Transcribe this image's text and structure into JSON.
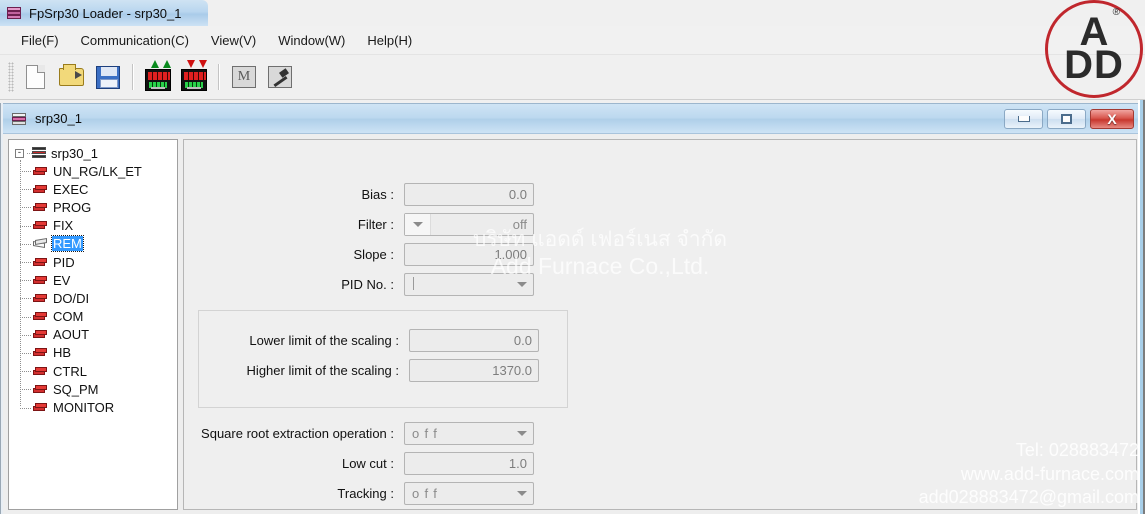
{
  "app": {
    "title": "FpSrp30 Loader - srp30_1",
    "icon": "books-stack-icon"
  },
  "menubar": {
    "items": [
      {
        "label": "File(F)",
        "name": "menu-file"
      },
      {
        "label": "Communication(C)",
        "name": "menu-communication"
      },
      {
        "label": "View(V)",
        "name": "menu-view"
      },
      {
        "label": "Window(W)",
        "name": "menu-window"
      },
      {
        "label": "Help(H)",
        "name": "menu-help"
      }
    ]
  },
  "toolbar": {
    "buttons": [
      {
        "name": "new-file-button",
        "icon": "new-document-icon",
        "title": "New"
      },
      {
        "name": "open-file-button",
        "icon": "open-folder-icon",
        "title": "Open"
      },
      {
        "name": "save-file-button",
        "icon": "floppy-disk-save-icon",
        "title": "Save"
      },
      {
        "name": "upload-button",
        "icon": "device-upload-green-arrows-icon",
        "title": "Upload"
      },
      {
        "name": "download-button",
        "icon": "device-download-red-arrows-icon",
        "title": "Download"
      },
      {
        "name": "monitor-button",
        "icon": "monitor-m-icon",
        "title": "Monitor"
      },
      {
        "name": "tools-button",
        "icon": "hammer-tool-icon",
        "title": "Tools"
      }
    ]
  },
  "mdi": {
    "title": "srp30_1",
    "icon": "document-pen-icon",
    "controls": {
      "minimize": "minimize-icon",
      "maximize": "maximize-icon",
      "close": "X"
    }
  },
  "tree": {
    "root": {
      "label": "srp30_1",
      "expander": "-"
    },
    "items": [
      {
        "label": "UN_RG/LK_ET",
        "selected": false
      },
      {
        "label": "EXEC",
        "selected": false
      },
      {
        "label": "PROG",
        "selected": false
      },
      {
        "label": "FIX",
        "selected": false
      },
      {
        "label": "REM",
        "selected": true
      },
      {
        "label": "PID",
        "selected": false
      },
      {
        "label": "EV",
        "selected": false
      },
      {
        "label": "DO/DI",
        "selected": false
      },
      {
        "label": "COM",
        "selected": false
      },
      {
        "label": "AOUT",
        "selected": false
      },
      {
        "label": "HB",
        "selected": false
      },
      {
        "label": "CTRL",
        "selected": false
      },
      {
        "label": "SQ_PM",
        "selected": false
      },
      {
        "label": "MONITOR",
        "selected": false
      }
    ]
  },
  "form": {
    "bias": {
      "label": "Bias :",
      "value": "0.0"
    },
    "filter": {
      "label": "Filter :",
      "value": "off"
    },
    "slope": {
      "label": "Slope :",
      "value": "1.000"
    },
    "pid_no": {
      "label": "PID No. :",
      "value": ""
    },
    "scaling": {
      "lower": {
        "label": "Lower limit of the scaling :",
        "value": "0.0"
      },
      "higher": {
        "label": "Higher limit of the scaling :",
        "value": "1370.0"
      }
    },
    "sqrt": {
      "label": "Square root extraction operation :",
      "value": "o f f"
    },
    "low_cut": {
      "label": "Low cut :",
      "value": "1.0"
    },
    "tracking": {
      "label": "Tracking :",
      "value": "o f f"
    }
  },
  "watermark": {
    "center_thai": "บริษัท แอดด์ เฟอร์เนส จำกัด",
    "center_english": "Add Furnace Co.,Ltd.",
    "tel": "Tel: 028883472",
    "website": "www.add-furnace.com",
    "email": "add028883472@gmail.com"
  },
  "logo": {
    "top": "A",
    "bottom": "DD",
    "registered": "®"
  },
  "colors": {
    "desktop": "#1d4e8f",
    "accent_selection": "#3399ff",
    "brand_red": "#c0272d",
    "window_chrome": "#bcd8ef",
    "panel": "#efefef"
  }
}
